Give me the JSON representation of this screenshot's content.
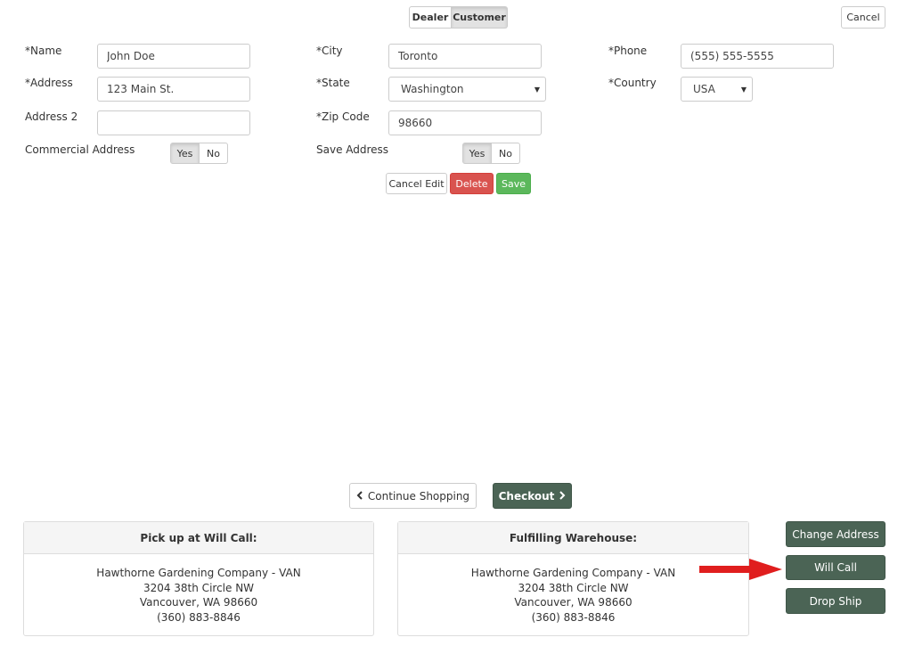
{
  "customer_type": {
    "options": [
      "Dealer",
      "Customer"
    ],
    "selected": "Customer"
  },
  "header": {
    "cancel_label": "Cancel"
  },
  "form": {
    "name_label": "*Name",
    "name_value": "John Doe",
    "address_label": "*Address",
    "address_value": "123 Main St.",
    "address2_label": "Address 2",
    "address2_value": "",
    "commercial_label": "Commercial Address",
    "commercial_yes": "Yes",
    "commercial_no": "No",
    "commercial_selected": "Yes",
    "city_label": "*City",
    "city_value": "Toronto",
    "state_label": "*State",
    "state_value": "Washington",
    "zip_label": "*Zip Code",
    "zip_value": "98660",
    "save_address_label": "Save Address",
    "save_yes": "Yes",
    "save_no": "No",
    "save_selected": "Yes",
    "phone_label": "*Phone",
    "phone_value": "(555) 555-5555",
    "country_label": "*Country",
    "country_value": "USA"
  },
  "form_actions": {
    "cancel_edit": "Cancel Edit",
    "delete": "Delete",
    "save": "Save"
  },
  "nav": {
    "continue_shopping": "Continue Shopping",
    "checkout": "Checkout"
  },
  "pickup_panel": {
    "title": "Pick up at Will Call:",
    "lines": [
      "Hawthorne Gardening Company - VAN",
      "3204 38th Circle NW",
      "Vancouver, WA 98660",
      "(360) 883-8846"
    ]
  },
  "warehouse_panel": {
    "title": "Fulfilling Warehouse:",
    "lines": [
      "Hawthorne Gardening Company - VAN",
      "3204 38th Circle NW",
      "Vancouver, WA 98660",
      "(360) 883-8846"
    ]
  },
  "shipping_actions": {
    "change_address": "Change Address",
    "will_call": "Will Call",
    "drop_ship": "Drop Ship"
  },
  "colors": {
    "dark_green": "#4b6455",
    "delete_red": "#d9534f",
    "save_green": "#5cb85c",
    "arrow_red": "#e01e1e"
  },
  "icons": [
    "chevron-left-icon",
    "chevron-right-icon",
    "caret-down-icon",
    "red-arrow-icon"
  ]
}
